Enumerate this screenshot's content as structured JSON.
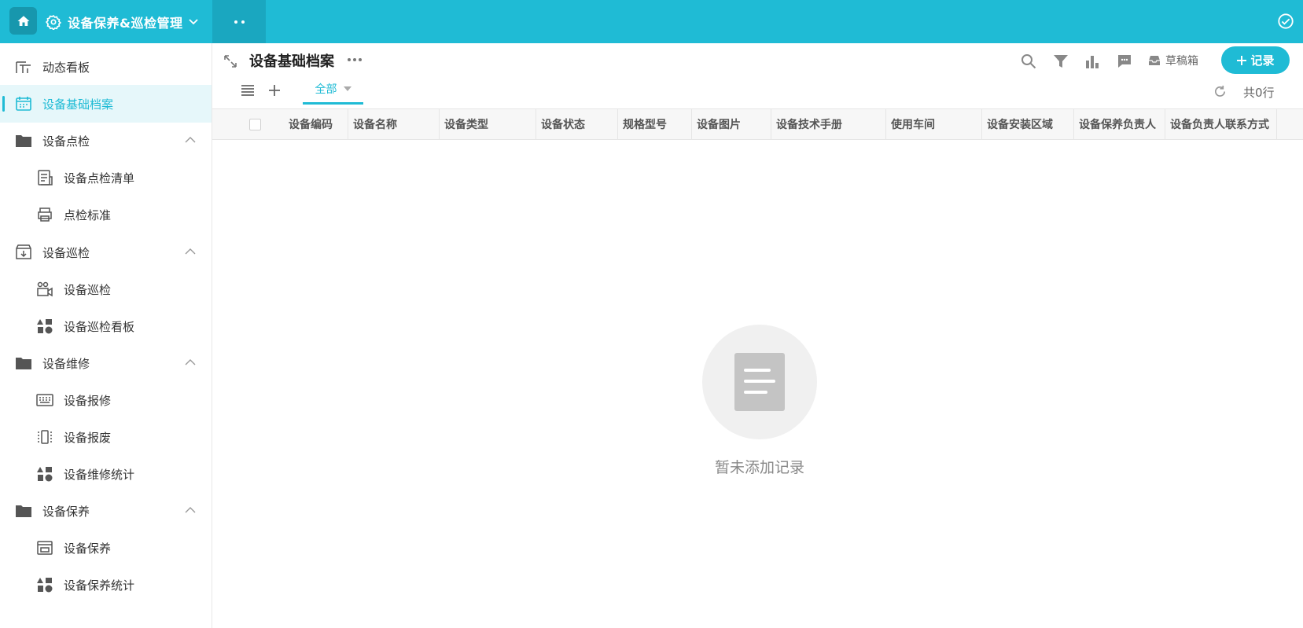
{
  "app": {
    "title": "设备保养&巡检管理"
  },
  "sidebar": {
    "items": [
      {
        "label": "动态看板",
        "icon": "dashboard-icon"
      },
      {
        "label": "设备基础档案",
        "icon": "calendar-icon",
        "active": true
      },
      {
        "label": "设备点检",
        "icon": "folder-icon",
        "group": true
      },
      {
        "label": "设备点检清单",
        "icon": "list-doc-icon"
      },
      {
        "label": "点检标准",
        "icon": "printer-icon"
      },
      {
        "label": "设备巡检",
        "icon": "inbox-download-icon",
        "group": true
      },
      {
        "label": "设备巡检",
        "icon": "video-camera-icon"
      },
      {
        "label": "设备巡检看板",
        "icon": "shapes-icon"
      },
      {
        "label": "设备维修",
        "icon": "folder-icon",
        "group": true
      },
      {
        "label": "设备报修",
        "icon": "keyboard-icon"
      },
      {
        "label": "设备报废",
        "icon": "device-icon"
      },
      {
        "label": "设备维修统计",
        "icon": "shapes-icon"
      },
      {
        "label": "设备保养",
        "icon": "folder-icon",
        "group": true
      },
      {
        "label": "设备保养",
        "icon": "calendar-box-icon"
      },
      {
        "label": "设备保养统计",
        "icon": "shapes-icon"
      }
    ]
  },
  "main": {
    "title": "设备基础档案",
    "draft_label": "草稿箱",
    "add_label": "记录",
    "tab_all": "全部",
    "row_count": "共0行",
    "columns": [
      "设备编码",
      "设备名称",
      "设备类型",
      "设备状态",
      "规格型号",
      "设备图片",
      "设备技术手册",
      "使用车间",
      "设备安装区域",
      "设备保养负责人",
      "设备负责人联系方式"
    ],
    "empty_text": "暂未添加记录"
  },
  "colors": {
    "accent": "#1fbbd5"
  }
}
